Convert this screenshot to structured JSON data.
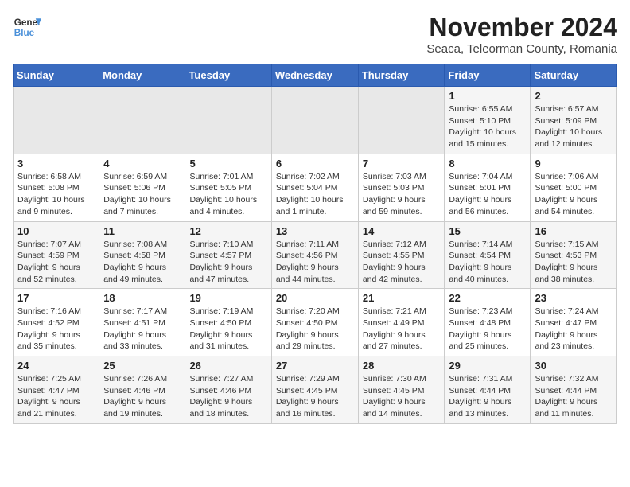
{
  "logo": {
    "line1": "General",
    "line2": "Blue"
  },
  "title": "November 2024",
  "subtitle": "Seaca, Teleorman County, Romania",
  "headers": [
    "Sunday",
    "Monday",
    "Tuesday",
    "Wednesday",
    "Thursday",
    "Friday",
    "Saturday"
  ],
  "weeks": [
    [
      {
        "day": "",
        "info": ""
      },
      {
        "day": "",
        "info": ""
      },
      {
        "day": "",
        "info": ""
      },
      {
        "day": "",
        "info": ""
      },
      {
        "day": "",
        "info": ""
      },
      {
        "day": "1",
        "info": "Sunrise: 6:55 AM\nSunset: 5:10 PM\nDaylight: 10 hours and 15 minutes."
      },
      {
        "day": "2",
        "info": "Sunrise: 6:57 AM\nSunset: 5:09 PM\nDaylight: 10 hours and 12 minutes."
      }
    ],
    [
      {
        "day": "3",
        "info": "Sunrise: 6:58 AM\nSunset: 5:08 PM\nDaylight: 10 hours and 9 minutes."
      },
      {
        "day": "4",
        "info": "Sunrise: 6:59 AM\nSunset: 5:06 PM\nDaylight: 10 hours and 7 minutes."
      },
      {
        "day": "5",
        "info": "Sunrise: 7:01 AM\nSunset: 5:05 PM\nDaylight: 10 hours and 4 minutes."
      },
      {
        "day": "6",
        "info": "Sunrise: 7:02 AM\nSunset: 5:04 PM\nDaylight: 10 hours and 1 minute."
      },
      {
        "day": "7",
        "info": "Sunrise: 7:03 AM\nSunset: 5:03 PM\nDaylight: 9 hours and 59 minutes."
      },
      {
        "day": "8",
        "info": "Sunrise: 7:04 AM\nSunset: 5:01 PM\nDaylight: 9 hours and 56 minutes."
      },
      {
        "day": "9",
        "info": "Sunrise: 7:06 AM\nSunset: 5:00 PM\nDaylight: 9 hours and 54 minutes."
      }
    ],
    [
      {
        "day": "10",
        "info": "Sunrise: 7:07 AM\nSunset: 4:59 PM\nDaylight: 9 hours and 52 minutes."
      },
      {
        "day": "11",
        "info": "Sunrise: 7:08 AM\nSunset: 4:58 PM\nDaylight: 9 hours and 49 minutes."
      },
      {
        "day": "12",
        "info": "Sunrise: 7:10 AM\nSunset: 4:57 PM\nDaylight: 9 hours and 47 minutes."
      },
      {
        "day": "13",
        "info": "Sunrise: 7:11 AM\nSunset: 4:56 PM\nDaylight: 9 hours and 44 minutes."
      },
      {
        "day": "14",
        "info": "Sunrise: 7:12 AM\nSunset: 4:55 PM\nDaylight: 9 hours and 42 minutes."
      },
      {
        "day": "15",
        "info": "Sunrise: 7:14 AM\nSunset: 4:54 PM\nDaylight: 9 hours and 40 minutes."
      },
      {
        "day": "16",
        "info": "Sunrise: 7:15 AM\nSunset: 4:53 PM\nDaylight: 9 hours and 38 minutes."
      }
    ],
    [
      {
        "day": "17",
        "info": "Sunrise: 7:16 AM\nSunset: 4:52 PM\nDaylight: 9 hours and 35 minutes."
      },
      {
        "day": "18",
        "info": "Sunrise: 7:17 AM\nSunset: 4:51 PM\nDaylight: 9 hours and 33 minutes."
      },
      {
        "day": "19",
        "info": "Sunrise: 7:19 AM\nSunset: 4:50 PM\nDaylight: 9 hours and 31 minutes."
      },
      {
        "day": "20",
        "info": "Sunrise: 7:20 AM\nSunset: 4:50 PM\nDaylight: 9 hours and 29 minutes."
      },
      {
        "day": "21",
        "info": "Sunrise: 7:21 AM\nSunset: 4:49 PM\nDaylight: 9 hours and 27 minutes."
      },
      {
        "day": "22",
        "info": "Sunrise: 7:23 AM\nSunset: 4:48 PM\nDaylight: 9 hours and 25 minutes."
      },
      {
        "day": "23",
        "info": "Sunrise: 7:24 AM\nSunset: 4:47 PM\nDaylight: 9 hours and 23 minutes."
      }
    ],
    [
      {
        "day": "24",
        "info": "Sunrise: 7:25 AM\nSunset: 4:47 PM\nDaylight: 9 hours and 21 minutes."
      },
      {
        "day": "25",
        "info": "Sunrise: 7:26 AM\nSunset: 4:46 PM\nDaylight: 9 hours and 19 minutes."
      },
      {
        "day": "26",
        "info": "Sunrise: 7:27 AM\nSunset: 4:46 PM\nDaylight: 9 hours and 18 minutes."
      },
      {
        "day": "27",
        "info": "Sunrise: 7:29 AM\nSunset: 4:45 PM\nDaylight: 9 hours and 16 minutes."
      },
      {
        "day": "28",
        "info": "Sunrise: 7:30 AM\nSunset: 4:45 PM\nDaylight: 9 hours and 14 minutes."
      },
      {
        "day": "29",
        "info": "Sunrise: 7:31 AM\nSunset: 4:44 PM\nDaylight: 9 hours and 13 minutes."
      },
      {
        "day": "30",
        "info": "Sunrise: 7:32 AM\nSunset: 4:44 PM\nDaylight: 9 hours and 11 minutes."
      }
    ]
  ]
}
